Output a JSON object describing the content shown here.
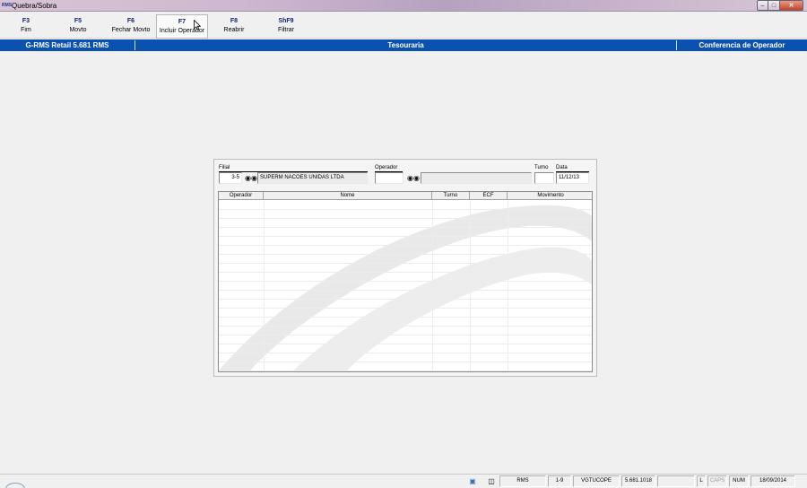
{
  "window": {
    "title": "Quebra/Sobra",
    "app_icon_text": "RMS"
  },
  "toolbar": {
    "buttons": [
      {
        "key": "F3",
        "label": "Fim"
      },
      {
        "key": "F5",
        "label": "Movto"
      },
      {
        "key": "F6",
        "label": "Fechar Movto"
      },
      {
        "key": "F7",
        "label": "Incluir Operador"
      },
      {
        "key": "F8",
        "label": "Reabrir"
      },
      {
        "key": "ShF9",
        "label": "Filtrar"
      }
    ]
  },
  "header_bar": {
    "left": "G-RMS Retail 5.681 RMS",
    "center": "Tesouraria",
    "right": "Conferencia de Operador",
    "color": "#0b52b0"
  },
  "form": {
    "filial_label": "Filial",
    "filial_value": "3-5",
    "filial_name": "SUPERM NACOES UNIDAS LTDA",
    "operador_label": "Operador",
    "operador_value": "",
    "operador_name": "",
    "turno_label": "Turno",
    "turno_value": "",
    "data_label": "Data",
    "data_value": "11/12/13"
  },
  "grid": {
    "columns": [
      "Operador",
      "Nome",
      "Turno",
      "ECF",
      "Movimento"
    ],
    "rows": []
  },
  "statusbar": {
    "cells": [
      "RMS",
      "1-9",
      "VGTUCOPE",
      "5.681.1018",
      "",
      "L",
      "CAPS",
      "NUM",
      "18/09/2014"
    ]
  },
  "icons": {
    "search": "binoculars-icon",
    "network": "network-icon",
    "clipboard": "clipboard-icon"
  }
}
